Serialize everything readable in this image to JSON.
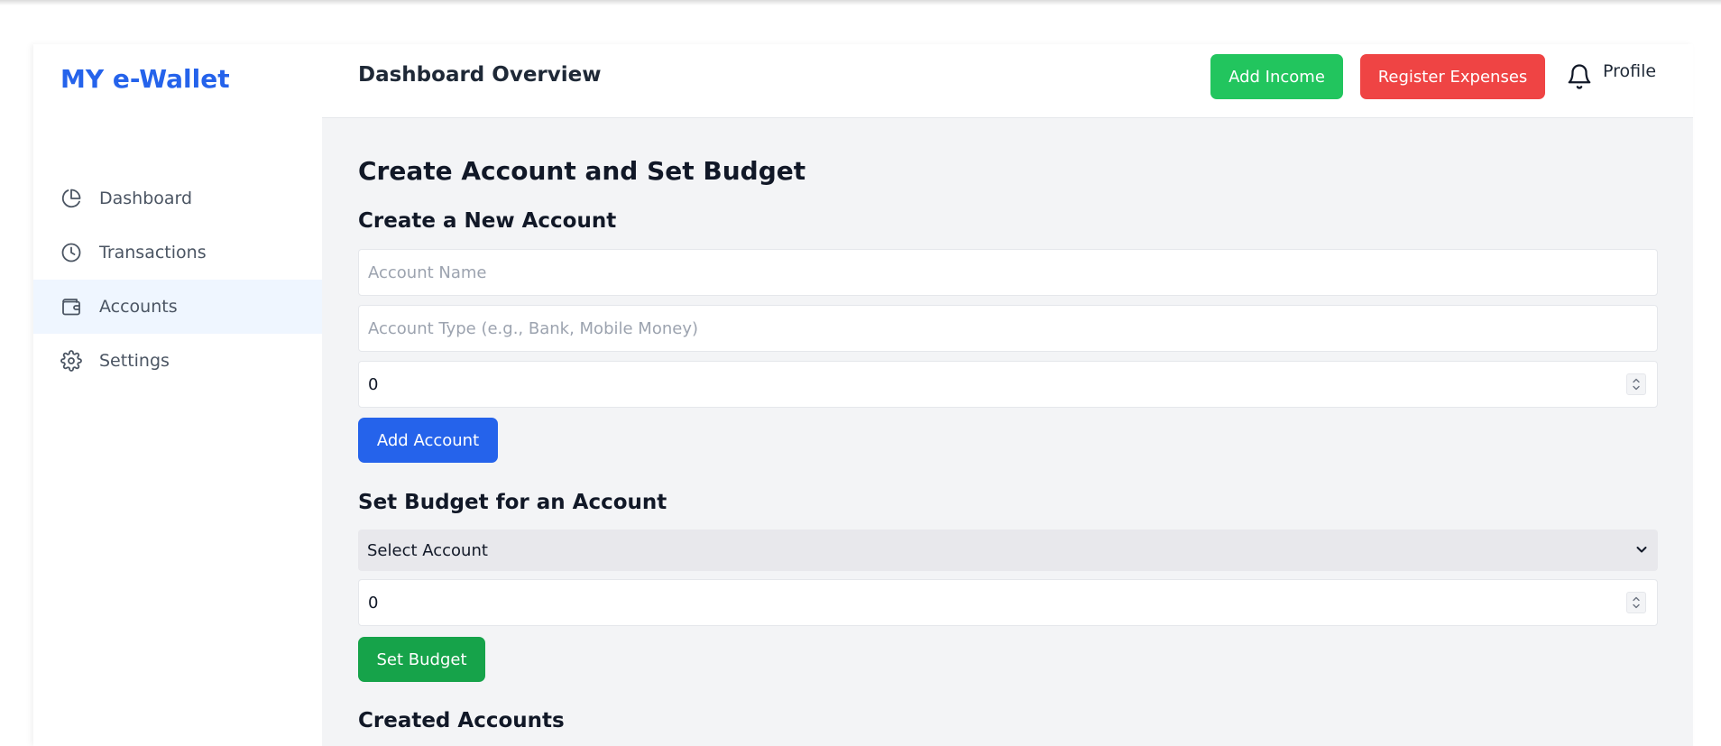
{
  "app": {
    "brand": "MY e-Wallet"
  },
  "sidebar": {
    "items": [
      {
        "label": "Dashboard",
        "icon": "pie-chart-icon"
      },
      {
        "label": "Transactions",
        "icon": "clock-icon"
      },
      {
        "label": "Accounts",
        "icon": "wallet-icon",
        "active": true
      },
      {
        "label": "Settings",
        "icon": "gear-icon"
      }
    ]
  },
  "header": {
    "title": "Dashboard Overview",
    "add_income_label": "Add Income",
    "register_expenses_label": "Register Expenses",
    "profile_label": "Profile"
  },
  "main": {
    "title": "Create Account and Set Budget",
    "create_account": {
      "heading": "Create a New Account",
      "name_placeholder": "Account Name",
      "type_placeholder": "Account Type (e.g., Bank, Mobile Money)",
      "balance_value": "0",
      "button_label": "Add Account"
    },
    "set_budget": {
      "heading": "Set Budget for an Account",
      "select_value": "Select Account",
      "amount_value": "0",
      "button_label": "Set Budget"
    },
    "created_accounts_heading": "Created Accounts"
  },
  "colors": {
    "brand": "#2563eb",
    "income": "#22c55e",
    "expense": "#ef4444",
    "primary": "#2563eb",
    "success": "#16a34a",
    "main_bg": "#f3f4f6",
    "active_nav_bg": "#eff6ff"
  }
}
